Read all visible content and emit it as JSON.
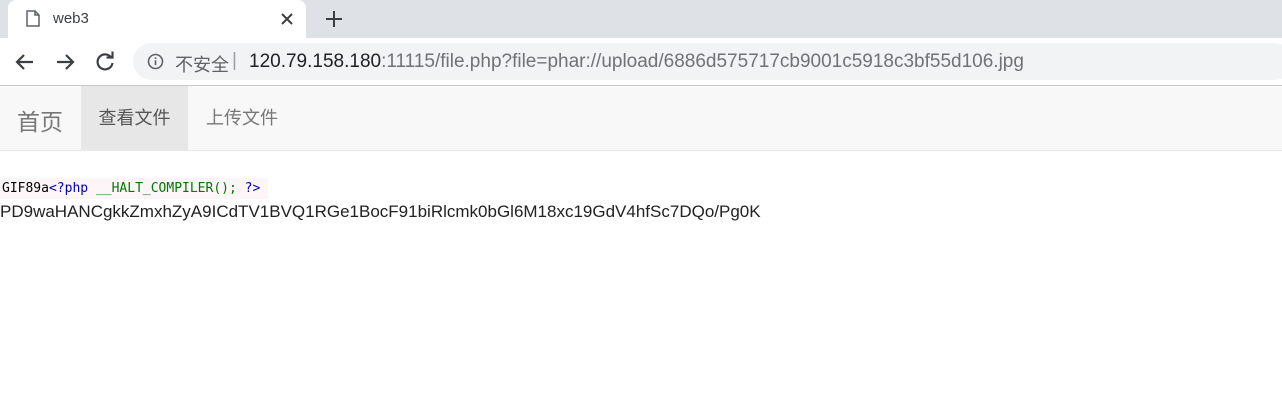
{
  "browser": {
    "tab": {
      "title": "web3",
      "favicon": "document-icon",
      "close": "close-icon"
    },
    "new_tab": "plus-icon",
    "toolbar": {
      "back": "arrow-left-icon",
      "forward": "arrow-right-icon",
      "reload": "reload-icon"
    },
    "omnibox": {
      "security_icon": "info-icon",
      "security_label": "不安全",
      "separator": "|",
      "url_host": "120.79.158.180",
      "url_rest": ":11115/file.php?file=phar://upload/6886d575717cb9001c5918c3bf55d106.jpg"
    }
  },
  "site_nav": {
    "brand": "首页",
    "items": [
      {
        "label": "查看文件",
        "active": true
      },
      {
        "label": "上传文件",
        "active": false
      }
    ]
  },
  "content": {
    "code": {
      "prefix": "GIF89a",
      "open_tag": "<?php",
      "statement": "__HALT_COMPILER();",
      "close_tag": "?>"
    },
    "base64": "PD9waHANCgkkZmxhZyA9ICdTV1BVQ1RGe1BocF91biRlcmk0bGl6M18xc19GdV4hfSc7DQo/Pg0K"
  },
  "colors": {
    "tabstrip": "#dee1e6",
    "omnibox": "#f1f3f4",
    "navbar": "#f8f8f8",
    "nav_active": "#e7e7e7",
    "php_tag": "#0000bb",
    "php_ident": "#007700"
  }
}
